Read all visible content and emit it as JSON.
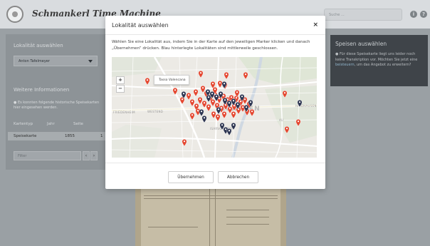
{
  "app": {
    "title": "Schmankerl Time Machine",
    "search_placeholder": "Suche ...",
    "icons": [
      "info-icon",
      "help-icon"
    ]
  },
  "left_panel": {
    "location_heading": "Lokalität auswählen",
    "location_value": "Anton Tafelmeyer",
    "more_info_heading": "Weitere Informationen",
    "info_text": "Es konnten folgende historische Speisekarten hier eingesehen werden.",
    "table_headers": [
      "Kartentyp",
      "Jahr",
      "Seite"
    ],
    "table_rows": [
      {
        "type": "Speisekarte",
        "year": "1855",
        "page": "1"
      }
    ],
    "filter_placeholder": "Filter",
    "pager_prev": "‹",
    "pager_next": "›"
  },
  "right_panel": {
    "title": "Speisen auswählen",
    "text_before": "Für diese Speisekarte liegt uns leider noch keine Transkription vor. Möchten Sie jetzt eine",
    "link": "beisteuern",
    "text_after": ", um das Angebot zu erweitern?"
  },
  "modal": {
    "title": "Lokalität auswählen",
    "close_label": "×",
    "description": "Wählen Sie eine Lokalität aus, indem Sie in der Karte auf den jeweiligen Marker klicken und danach „Übernehmen“ drücken. Blau hinterlegte Lokalitäten sind mittlerweile geschlossen.",
    "zoom_in": "+",
    "zoom_out": "−",
    "tooltip": "Tasso Valencana",
    "map_labels": {
      "friedenheim": "FRIEDENHEIM",
      "westend": "WESTEND",
      "city": "MÜNCHEN",
      "isarvorstadt": "ISARVORSTADT",
      "haidhausen": "HAIDHAUSEN",
      "au": "AU"
    },
    "marker_colors": {
      "open": "#e4462f",
      "closed": "#2c3450"
    },
    "confirm_label": "Übernehmen",
    "cancel_label": "Abbrechen"
  }
}
